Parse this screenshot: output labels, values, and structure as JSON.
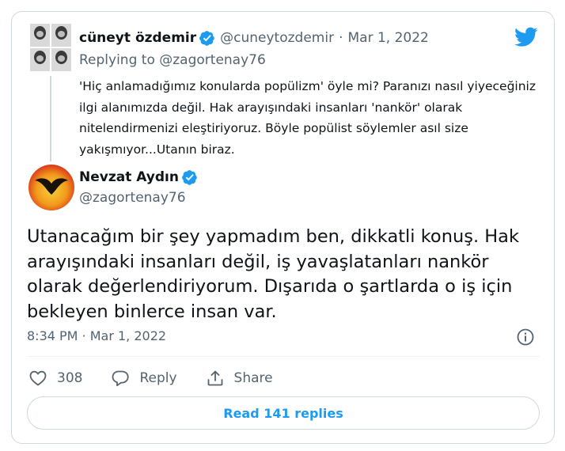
{
  "parent_tweet": {
    "display_name": "cüneyt özdemir",
    "handle": "@cuneytozdemir",
    "separator": "·",
    "date": "Mar 1, 2022",
    "replying_prefix": "Replying to",
    "replying_to": "@zagortenay76",
    "text": "'Hiç anlamadığımız konularda popülizm' öyle mi?  Paranızı nasıl yiyeceğiniz ilgi alanımızda değil. Hak arayışındaki insanları 'nankör' olarak nitelendirmenizi eleştiriyoruz. Böyle popülist söylemler asıl size yakışmıyor...Utanın biraz."
  },
  "main_tweet": {
    "display_name": "Nevzat Aydın",
    "handle": "@zagortenay76",
    "text": "Utanacağım bir şey yapmadım ben, dikkatli konuş. Hak arayışındaki insanları değil, iş yavaşlatanları nankör olarak değerlendiriyorum. Dışarıda o şartlarda o iş için bekleyen binlerce insan var.",
    "timestamp": "8:34 PM · Mar 1, 2022"
  },
  "actions": {
    "like_count": "308",
    "reply_label": "Reply",
    "share_label": "Share"
  },
  "read_replies_label": "Read 141 replies",
  "icons": {
    "brand": "twitter-bird-icon",
    "verified": "verified-badge-icon",
    "info": "info-icon",
    "like": "heart-icon",
    "reply": "speech-bubble-icon",
    "share": "share-upload-icon"
  },
  "colors": {
    "brand_blue": "#1d9bf0",
    "text_primary": "#0f1419",
    "text_muted": "#536471",
    "border": "#cfd9de"
  }
}
